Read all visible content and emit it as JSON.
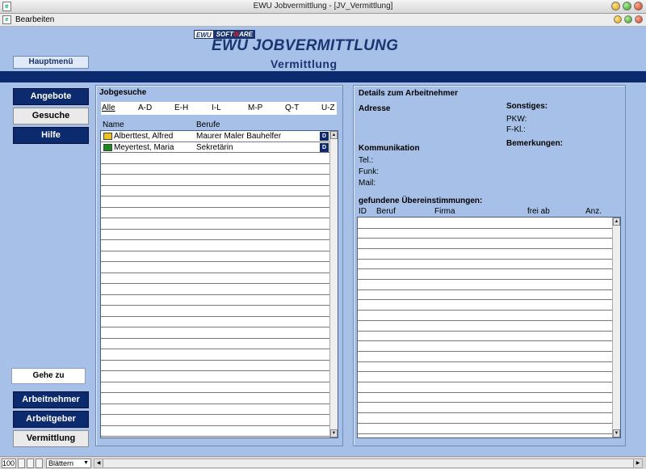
{
  "window": {
    "title": "EWU Jobvermittlung - [JV_Vermittlung]",
    "menu_item": "Bearbeiten"
  },
  "header": {
    "logo_part1": "EWU",
    "logo_part2_a": "SOFT",
    "logo_part2_b": "W",
    "logo_part2_c": "ARE",
    "app_title": "EWU JOBVERMITTLUNG",
    "subtitle": "Vermittlung",
    "hauptmenu_label": "Hauptmenü"
  },
  "nav": {
    "angebote": "Angebote",
    "gesuche": "Gesuche",
    "hilfe": "Hilfe",
    "goto_label": "Gehe zu",
    "arbeitnehmer": "Arbeitnehmer",
    "arbeitgeber": "Arbeitgeber",
    "vermittlung": "Vermittlung"
  },
  "jobgesuche": {
    "title": "Jobgesuche",
    "filters": [
      "Alle",
      "A-D",
      "E-H",
      "I-L",
      "M-P",
      "Q-T",
      "U-Z"
    ],
    "col_name": "Name",
    "col_berufe": "Berufe",
    "rows": [
      {
        "name": "Alberttest, Alfred",
        "beruf": "Maurer Maler Bauhelfer",
        "color": "#f0c020",
        "btn": "D"
      },
      {
        "name": "Meyertest, Maria",
        "beruf": "Sekretärin",
        "color": "#1a8a1a",
        "btn": "D"
      }
    ]
  },
  "details": {
    "title": "Details zum Arbeitnehmer",
    "adresse": "Adresse",
    "sonstiges": "Sonstiges:",
    "pkw": "PKW:",
    "fkl": "F-Kl.:",
    "bemerkungen": "Bemerkungen:",
    "kommunikation": "Kommunikation",
    "tel": "Tel.:",
    "funk": "Funk:",
    "mail": "Mail:",
    "matches_title": "gefundene Übereinstimmungen:",
    "col_id": "ID",
    "col_beruf": "Beruf",
    "col_firma": "Firma",
    "col_frei_ab": "frei ab",
    "col_anz": "Anz."
  },
  "statusbar": {
    "zoom": "100",
    "mode": "Blättern"
  },
  "colors": {
    "dark_blue": "#0c2a6e",
    "panel_bg": "#a6c0e8"
  }
}
